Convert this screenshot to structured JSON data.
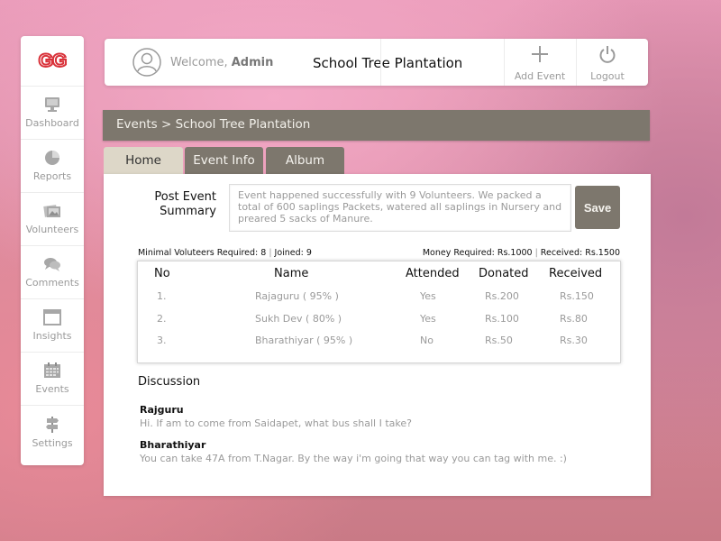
{
  "sidebar": {
    "logo": "GG",
    "items": [
      {
        "label": "Dashboard",
        "icon": "monitor-icon"
      },
      {
        "label": "Reports",
        "icon": "pie-chart-icon"
      },
      {
        "label": "Volunteers",
        "icon": "photos-icon"
      },
      {
        "label": "Comments",
        "icon": "chat-bubbles-icon"
      },
      {
        "label": "Insights",
        "icon": "window-icon"
      },
      {
        "label": "Events",
        "icon": "calendar-icon"
      },
      {
        "label": "Settings",
        "icon": "signpost-icon"
      }
    ]
  },
  "header": {
    "welcome_prefix": "Welcome,",
    "user": "Admin",
    "title": "School Tree Plantation",
    "add_event_label": "Add Event",
    "logout_label": "Logout"
  },
  "breadcrumb": "Events > School Tree Plantation",
  "tabs": [
    {
      "label": "Home",
      "active": true
    },
    {
      "label": "Event Info",
      "active": false
    },
    {
      "label": "Album",
      "active": false
    }
  ],
  "summary": {
    "label_line1": "Post Event",
    "label_line2": "Summary",
    "text": "Event happened successfully with 9 Volunteers. We packed a total of 600 saplings Packets, watered all saplings in Nursery and preared 5 sacks of Manure.",
    "save_label": "Save"
  },
  "stats": {
    "min_volunteers": "Minimal Voluteers Required: 8",
    "joined": "Joined: 9",
    "money_required": "Money Required: Rs.1000",
    "received": "Received: Rs.1500"
  },
  "table": {
    "headers": [
      "No",
      "Name",
      "Attended",
      "Donated",
      "Received"
    ],
    "rows": [
      [
        "1.",
        "Rajaguru ( 95% )",
        "Yes",
        "Rs.200",
        "Rs.150"
      ],
      [
        "2.",
        "Sukh Dev ( 80% )",
        "Yes",
        "Rs.100",
        "Rs.80"
      ],
      [
        "3.",
        "Bharathiyar ( 95% )",
        "No",
        "Rs.50",
        "Rs.30"
      ]
    ]
  },
  "discussion": {
    "title": "Discussion",
    "comments": [
      {
        "author": "Rajguru",
        "text": "Hi. If am to come from Saidapet, what bus shall I take?"
      },
      {
        "author": "Bharathiyar",
        "text": "You can take 47A from T.Nagar. By the way i'm going that way you can tag with me. :)"
      }
    ]
  },
  "colors": {
    "accent_dark": "#7d776d",
    "tab_active": "#ddd7c8",
    "logo_red": "#d9323a",
    "muted_text": "#9a9a9a"
  }
}
